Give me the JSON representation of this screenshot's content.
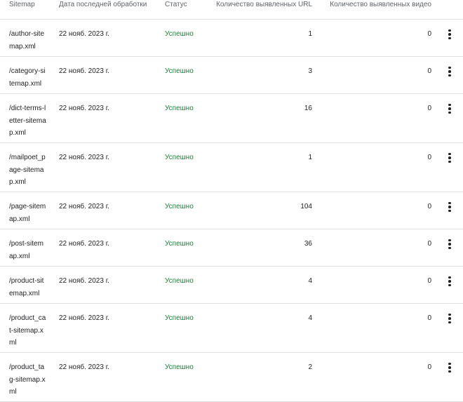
{
  "columns": {
    "sitemap": "Sitemap",
    "date": "Дата последней обработки",
    "status": "Статус",
    "urls": "Количество выявленных URL",
    "videos": "Количество выявленных видео"
  },
  "rows": [
    {
      "sitemap": "/author-sitemap.xml",
      "date": "22 нояб. 2023 г.",
      "status": "Успешно",
      "urls": "1",
      "videos": "0"
    },
    {
      "sitemap": "/category-sitemap.xml",
      "date": "22 нояб. 2023 г.",
      "status": "Успешно",
      "urls": "3",
      "videos": "0"
    },
    {
      "sitemap": "/dict-terms-letter-sitemap.xml",
      "date": "22 нояб. 2023 г.",
      "status": "Успешно",
      "urls": "16",
      "videos": "0"
    },
    {
      "sitemap": "/mailpoet_page-sitemap.xml",
      "date": "22 нояб. 2023 г.",
      "status": "Успешно",
      "urls": "1",
      "videos": "0"
    },
    {
      "sitemap": "/page-sitemap.xml",
      "date": "22 нояб. 2023 г.",
      "status": "Успешно",
      "urls": "104",
      "videos": "0"
    },
    {
      "sitemap": "/post-sitemap.xml",
      "date": "22 нояб. 2023 г.",
      "status": "Успешно",
      "urls": "36",
      "videos": "0"
    },
    {
      "sitemap": "/product-sitemap.xml",
      "date": "22 нояб. 2023 г.",
      "status": "Успешно",
      "urls": "4",
      "videos": "0"
    },
    {
      "sitemap": "/product_cat-sitemap.xml",
      "date": "22 нояб. 2023 г.",
      "status": "Успешно",
      "urls": "4",
      "videos": "0"
    },
    {
      "sitemap": "/product_tag-sitemap.xml",
      "date": "22 нояб. 2023 г.",
      "status": "Успешно",
      "urls": "2",
      "videos": "0"
    }
  ],
  "icons": {
    "row_menu": "more-vert-icon"
  },
  "colors": {
    "status_success": "#188038",
    "divider": "#e0e0e0",
    "header_text": "#5f6368"
  }
}
